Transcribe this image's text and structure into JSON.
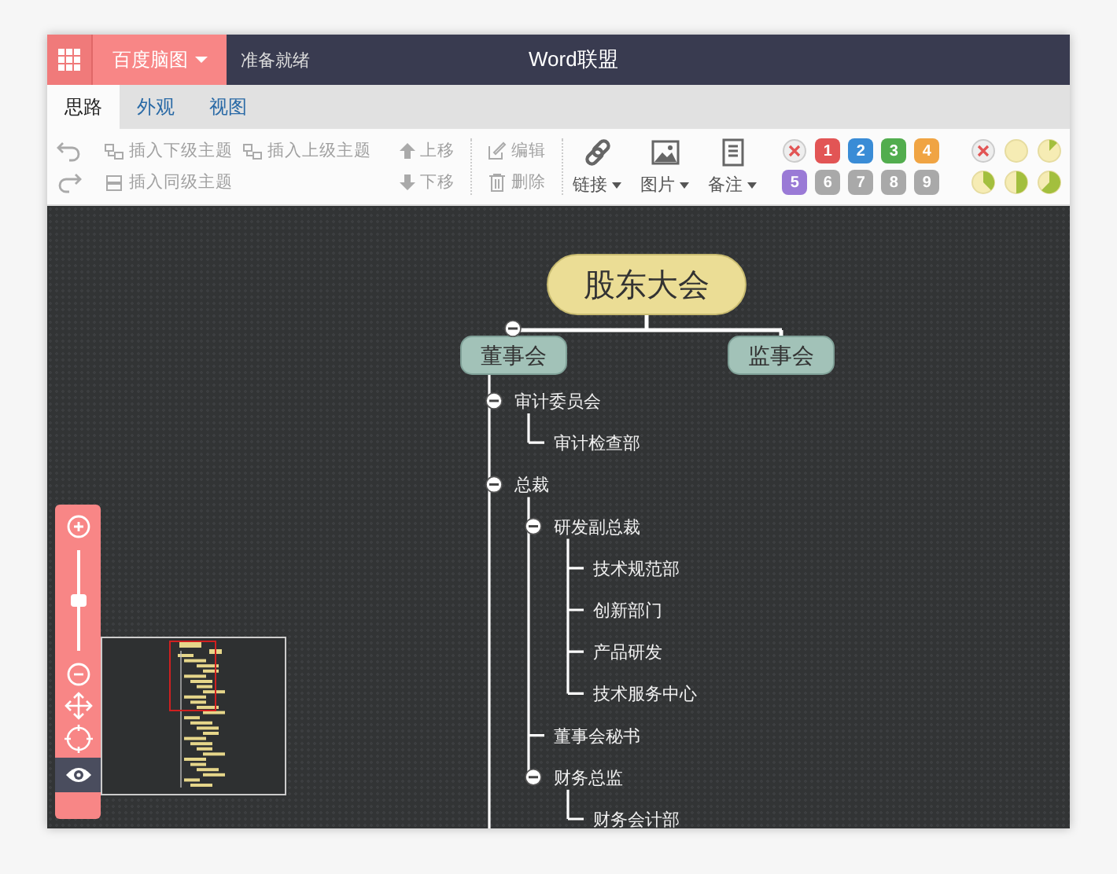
{
  "app_bar": {
    "brand": "百度脑图",
    "status": "准备就绪",
    "title": "Word联盟"
  },
  "tabs": [
    {
      "label": "思路",
      "selected": true
    },
    {
      "label": "外观",
      "selected": false
    },
    {
      "label": "视图",
      "selected": false
    }
  ],
  "toolbar": {
    "insert_child": "插入下级主题",
    "insert_parent": "插入上级主题",
    "insert_sibling": "插入同级主题",
    "move_up": "上移",
    "move_down": "下移",
    "edit": "编辑",
    "delete": "删除",
    "link": "链接",
    "image": "图片",
    "note": "备注",
    "priorities": [
      {
        "label": "1",
        "color": "#e25555"
      },
      {
        "label": "2",
        "color": "#3a8cd6"
      },
      {
        "label": "3",
        "color": "#52ad4e"
      },
      {
        "label": "4",
        "color": "#f0a443"
      },
      {
        "label": "5",
        "color": "#9a7ad6"
      },
      {
        "label": "6",
        "color": "#a9a9a9"
      },
      {
        "label": "7",
        "color": "#a9a9a9"
      },
      {
        "label": "8",
        "color": "#a9a9a9"
      },
      {
        "label": "9",
        "color": "#a9a9a9"
      }
    ]
  },
  "mindmap": {
    "root": {
      "text": "股东大会",
      "children": [
        {
          "text": "董事会",
          "expanded": true,
          "children": [
            {
              "text": "审计委员会",
              "expanded": true,
              "children": [
                {
                  "text": "审计检查部"
                }
              ]
            },
            {
              "text": "总裁",
              "expanded": true,
              "children": [
                {
                  "text": "研发副总裁",
                  "expanded": true,
                  "children": [
                    {
                      "text": "技术规范部"
                    },
                    {
                      "text": "创新部门"
                    },
                    {
                      "text": "产品研发"
                    },
                    {
                      "text": "技术服务中心"
                    }
                  ]
                },
                {
                  "text": "董事会秘书"
                },
                {
                  "text": "财务总监",
                  "expanded": true,
                  "children": [
                    {
                      "text": "财务会计部"
                    }
                  ]
                }
              ]
            }
          ]
        },
        {
          "text": "监事会"
        }
      ]
    }
  },
  "zoom": {
    "level": 0.5
  },
  "navigator": {
    "on": true
  }
}
